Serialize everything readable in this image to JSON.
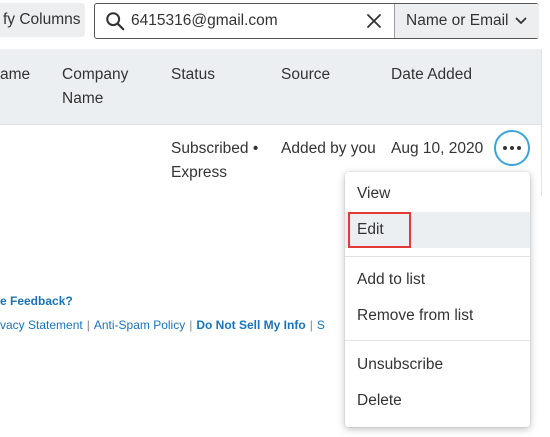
{
  "toolbar": {
    "columns_button_label": "fy Columns",
    "search_value": "6415316@gmail.com",
    "search_type_label": "Name or Email"
  },
  "table": {
    "headers": {
      "name": "ame",
      "company": "Company Name",
      "status": "Status",
      "source": "Source",
      "date_added": "Date Added"
    },
    "rows": [
      {
        "status": "Subscribed • Express",
        "source": "Added by you",
        "date_added": "Aug 10, 2020"
      }
    ]
  },
  "footer": {
    "feedback": "e Feedback?",
    "links": [
      "vacy Statement",
      "Anti-Spam Policy",
      "Do Not Sell My Info",
      "S"
    ]
  },
  "row_menu": {
    "items": [
      "View",
      "Edit",
      "Add to list",
      "Remove from list",
      "Unsubscribe",
      "Delete"
    ],
    "highlight_color": "#e53935"
  },
  "colors": {
    "accent": "#3ba4d8",
    "link": "#1a73b8",
    "header_bg": "#eceff1"
  }
}
